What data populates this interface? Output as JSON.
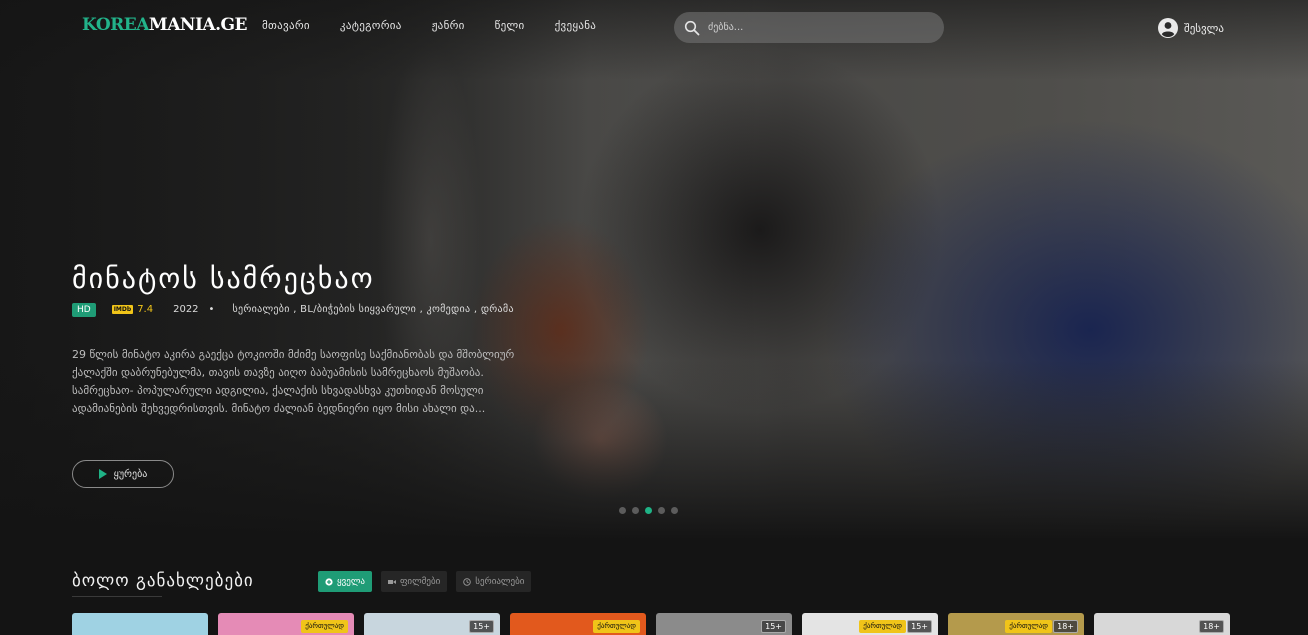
{
  "header": {
    "logo_part1": "KOREA",
    "logo_part2": "MANIA.GE",
    "nav": [
      "მთავარი",
      "კატეგორია",
      "ჟანრი",
      "წელი",
      "ქვეყანა"
    ],
    "search_placeholder": "ძებნა...",
    "login_label": "შესვლა"
  },
  "hero": {
    "title": "მინატოს სამრეცხაო",
    "quality": "HD",
    "imdb_label": "IMDb",
    "rating": "7.4",
    "year": "2022",
    "separator": "•",
    "genres": "სერიალები , BL/ბიჭების სიყვარული , კომედია , დრამა",
    "description": "29 წლის მინატო აკირა გაექცა ტოკიოში მძიმე საოფისე საქმიანობას და მშობლიურ ქალაქში დაბრუნებულმა, თავის თავზე აიღო ბაბუამისის სამრეცხაოს მუშაობა. სამრეცხაო- პოპულარული ადგილია, ქალაქის სხვადასხვა კუთხიდან მოსული ადამიანების შეხვედრისთვის. მინატო ძალიან ბედნიერი იყო მისი ახალი და...",
    "watch_label": "ყურება",
    "slides": 5,
    "active_slide": 2
  },
  "latest": {
    "title": "ბოლო განახლებები",
    "filters": [
      {
        "label": "ყველა",
        "icon": "plus-circle-icon",
        "active": true
      },
      {
        "label": "ფილმები",
        "icon": "video-camera-icon",
        "active": false
      },
      {
        "label": "სერიალები",
        "icon": "clock-icon",
        "active": false
      }
    ],
    "cards": [
      {
        "badge": "",
        "lang": "",
        "color": "#9fd2e3"
      },
      {
        "badge": "",
        "lang": "ქართულად",
        "color": "#e58bb6"
      },
      {
        "badge": "15+",
        "lang": "",
        "color": "#c8d6de"
      },
      {
        "badge": "",
        "lang": "ქართულად",
        "color": "#e2591d"
      },
      {
        "badge": "15+",
        "lang": "",
        "color": "#8b8b8b"
      },
      {
        "badge": "15+",
        "lang": "ქართულად",
        "color": "#e4e4e4"
      },
      {
        "badge": "18+",
        "lang": "ქართულად",
        "color": "#b49a4c"
      },
      {
        "badge": "18+",
        "lang": "",
        "color": "#d8d8d8"
      }
    ]
  },
  "colors": {
    "accent": "#1fb386",
    "rating": "#f0c419",
    "background": "#141414"
  }
}
